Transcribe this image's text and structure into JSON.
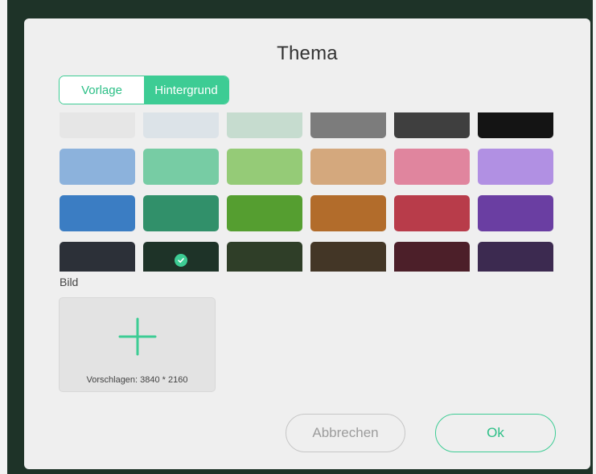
{
  "dialog": {
    "title": "Thema",
    "tabs": [
      {
        "label": "Vorlage",
        "active": false
      },
      {
        "label": "Hintergrund",
        "active": true
      }
    ],
    "image_section_label": "Bild",
    "upload_hint": "Vorschlagen: 3840 * 2160",
    "cancel_label": "Abbrechen",
    "ok_label": "Ok"
  },
  "colors": {
    "accent": "#3dcc94",
    "backdrop": "#1e3328",
    "dialog_bg": "#efefef"
  },
  "swatch_rows": [
    [
      "#e6e6e6",
      "#dce3e8",
      "#c6dccf",
      "#7c7c7c",
      "#3f3f3f",
      "#141414"
    ],
    [
      "#8cb2dc",
      "#77cca4",
      "#95cb77",
      "#d4a87d",
      "#e0859e",
      "#b190e3"
    ],
    [
      "#3b7dc3",
      "#31906a",
      "#559e30",
      "#b26c2b",
      "#b83c4a",
      "#6a3ea2"
    ],
    [
      "#2c3038",
      "#1e3328",
      "#2f3e28",
      "#433626",
      "#4c1f29",
      "#3c2a50"
    ]
  ],
  "selected_swatch": {
    "row": 3,
    "col": 1
  }
}
